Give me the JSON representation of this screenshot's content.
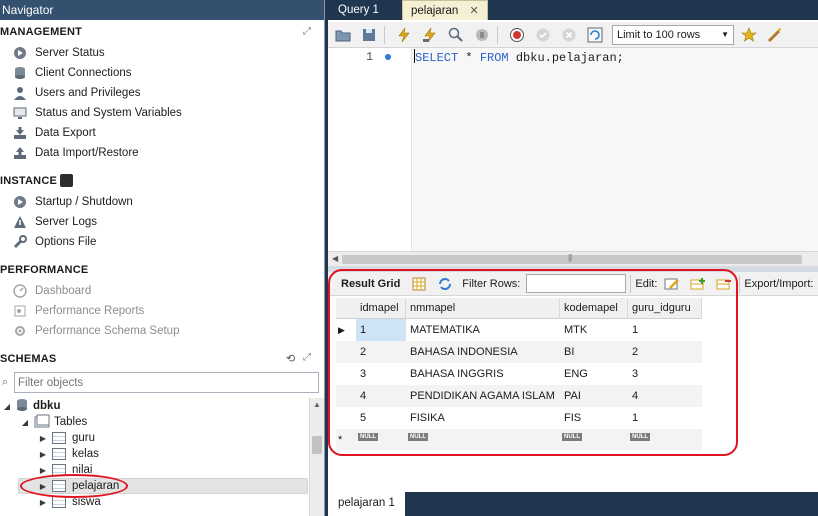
{
  "navigator": {
    "title": "Navigator",
    "management": {
      "header": "MANAGEMENT",
      "items": [
        {
          "label": "Server Status"
        },
        {
          "label": "Client Connections"
        },
        {
          "label": "Users and Privileges"
        },
        {
          "label": "Status and System Variables"
        },
        {
          "label": "Data Export"
        },
        {
          "label": "Data Import/Restore"
        }
      ]
    },
    "instance": {
      "header": "INSTANCE",
      "items": [
        {
          "label": "Startup / Shutdown"
        },
        {
          "label": "Server Logs"
        },
        {
          "label": "Options File"
        }
      ]
    },
    "performance": {
      "header": "PERFORMANCE",
      "items": [
        {
          "label": "Dashboard"
        },
        {
          "label": "Performance Reports"
        },
        {
          "label": "Performance Schema Setup"
        }
      ]
    },
    "schemas": {
      "header": "SCHEMAS",
      "filter_placeholder": "Filter objects",
      "schema": "dbku",
      "tables_label": "Tables",
      "tables": [
        "guru",
        "kelas",
        "nilai",
        "pelajaran",
        "siswa"
      ]
    }
  },
  "editor": {
    "tabs": {
      "query1": "Query 1",
      "pelajaran": "pelajaran",
      "close": "✕"
    },
    "toolbar": {
      "limit": "Limit to 100 rows"
    },
    "line_number": "1",
    "sql": {
      "kw1": "SELECT",
      "mid": " * ",
      "kw2": "FROM",
      "rest": " dbku.pelajaran;"
    }
  },
  "result": {
    "bar": {
      "grid_label": "Result Grid",
      "filter_label": "Filter Rows:",
      "edit_label": "Edit:",
      "export_label": "Export/Import:"
    },
    "columns": [
      "idmapel",
      "nmmapel",
      "kodemapel",
      "guru_idguru"
    ],
    "rows": [
      [
        "1",
        "MATEMATIKA",
        "MTK",
        "1"
      ],
      [
        "2",
        "BAHASA INDONESIA",
        "BI",
        "2"
      ],
      [
        "3",
        "BAHASA INGGRIS",
        "ENG",
        "3"
      ],
      [
        "4",
        "PENDIDIKAN AGAMA ISLAM",
        "PAI",
        "4"
      ],
      [
        "5",
        "FISIKA",
        "FIS",
        "1"
      ]
    ],
    "new_row_marker": "*",
    "null_label": "NULL",
    "bottom_tab": "pelajaran 1"
  },
  "colors": {
    "accent": "#1f3550",
    "highlight": "#e0141e",
    "selected_cell": "#cfe3f7"
  }
}
